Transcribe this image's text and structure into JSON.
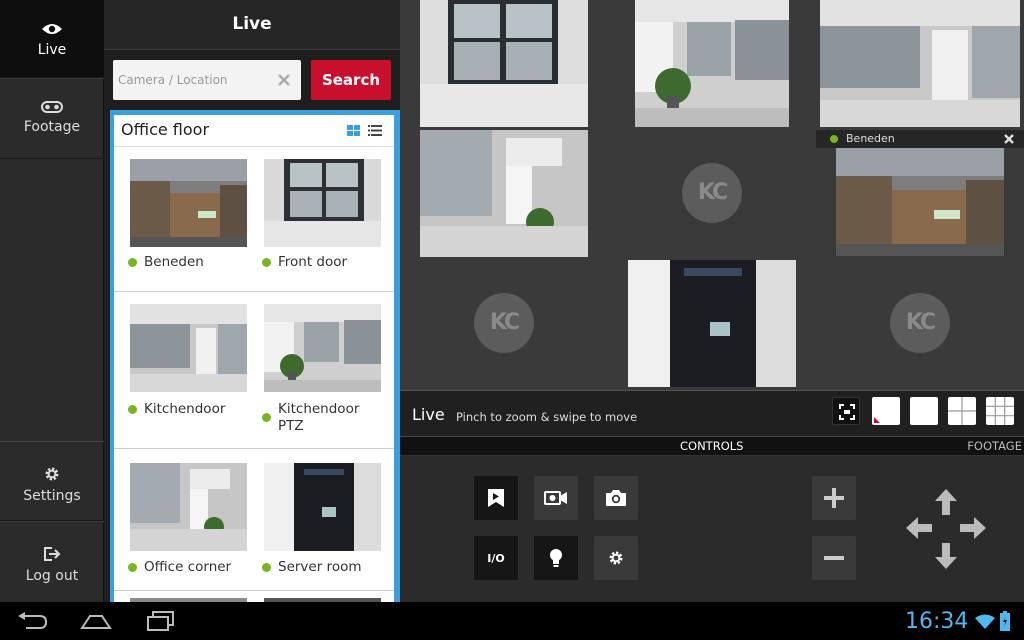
{
  "nav": {
    "live": "Live",
    "footage": "Footage",
    "settings": "Settings",
    "logout": "Log out"
  },
  "panel": {
    "title": "Live",
    "search_placeholder": "Camera / Location",
    "search_button": "Search",
    "list_title": "Office floor",
    "cameras": [
      {
        "name": "Beneden",
        "status": "online"
      },
      {
        "name": "Front door",
        "status": "online"
      },
      {
        "name": "Kitchendoor",
        "status": "online"
      },
      {
        "name": "Kitchendoor PTZ",
        "status": "online"
      },
      {
        "name": "Office corner",
        "status": "online"
      },
      {
        "name": "Server room",
        "status": "online"
      }
    ]
  },
  "video": {
    "placeholder_logo": "KC",
    "selected_camera": "Beneden"
  },
  "livebar": {
    "title": "Live",
    "hint": "Pinch to zoom & swipe to move"
  },
  "tabs": {
    "controls": "CONTROLS",
    "footage": "FOOTAGE"
  },
  "controls": {
    "io_label": "I/O"
  },
  "system": {
    "time": "16:34"
  },
  "colors": {
    "accent_red": "#c8102e",
    "list_border_blue": "#3aa0dd",
    "status_green": "#7ab520",
    "clock_blue": "#4fb8ef"
  }
}
